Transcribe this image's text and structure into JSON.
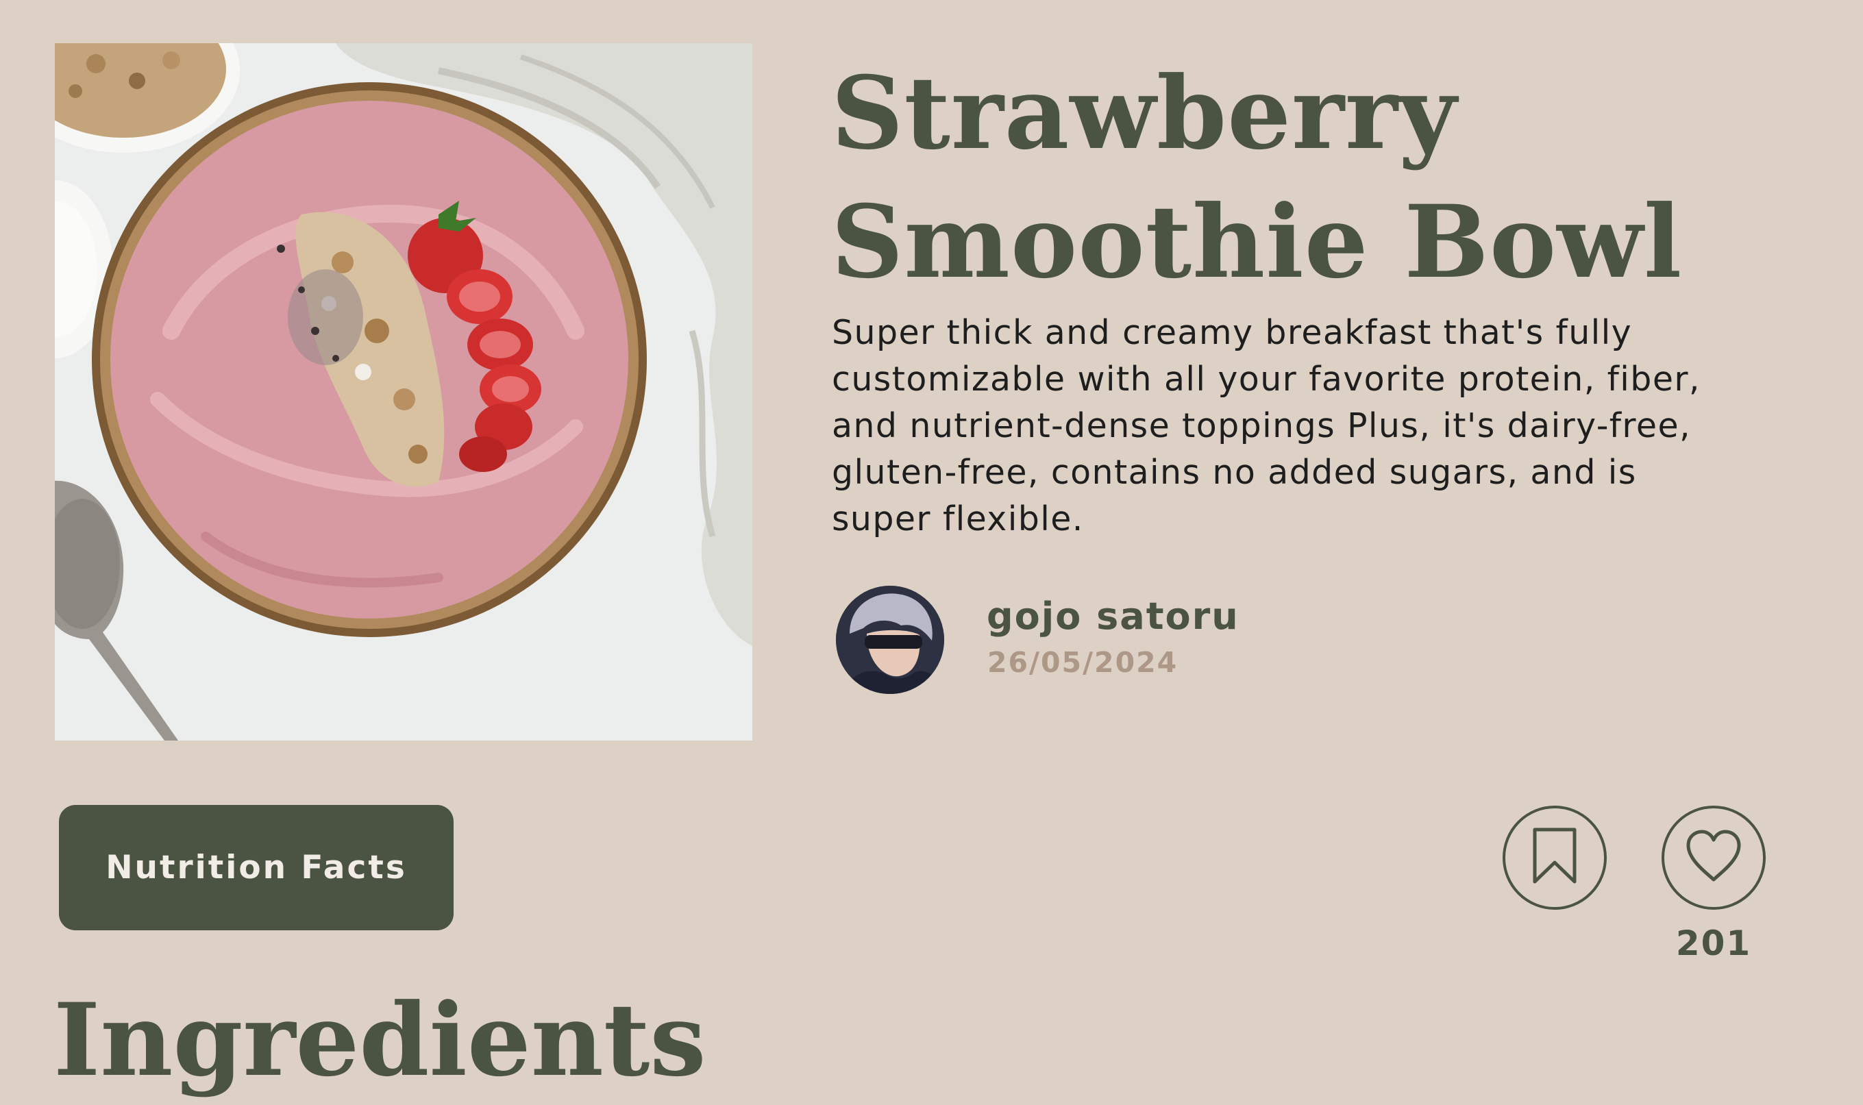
{
  "recipe": {
    "title": "Strawberry Smoothie Bowl",
    "description": "Super thick and creamy breakfast that's fully customizable with all your favorite protein, fiber, and nutrient-dense toppings Plus, it's dairy-free, gluten-free, contains no added sugars, and is super flexible.",
    "image_subject": "strawberry smoothie bowl"
  },
  "author": {
    "name": "gojo satoru",
    "date": "26/05/2024"
  },
  "actions": {
    "nutrition_label": "Nutrition Facts",
    "bookmark_icon": "bookmark-icon",
    "like_icon": "heart-icon",
    "like_count": "201"
  },
  "sections": {
    "ingredients_heading": "Ingredients"
  },
  "colors": {
    "background": "#ddd1c6",
    "primary": "#4b5443",
    "muted": "#ad9887",
    "text": "#1e1e1e"
  }
}
